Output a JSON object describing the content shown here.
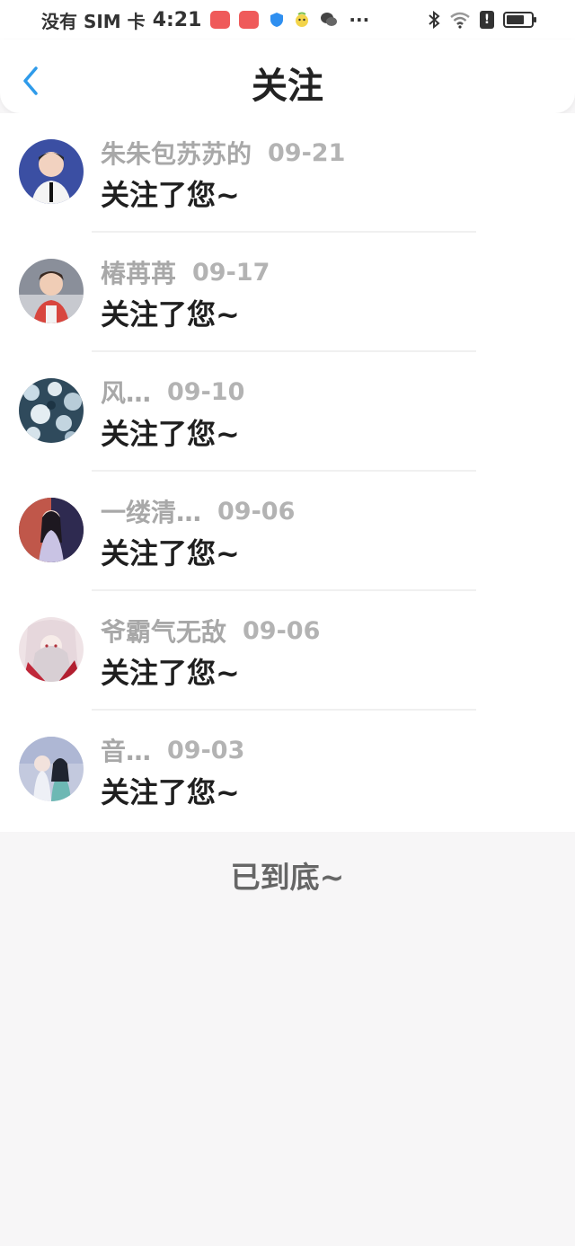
{
  "status_bar": {
    "carrier": "没有 SIM 卡",
    "time": "4:21",
    "more": "···",
    "alert": "!"
  },
  "header": {
    "title": "关注"
  },
  "notifications": [
    {
      "name": "朱朱包苏苏的",
      "date": "09-21",
      "message": "关注了您~"
    },
    {
      "name": "椿苒苒",
      "date": "09-17",
      "message": "关注了您~"
    },
    {
      "name": "风…",
      "date": "09-10",
      "message": "关注了您~"
    },
    {
      "name": "一缕清…",
      "date": "09-06",
      "message": "关注了您~"
    },
    {
      "name": "爷霸气无敌",
      "date": "09-06",
      "message": "关注了您~"
    },
    {
      "name": "音…",
      "date": "09-03",
      "message": "关注了您~"
    }
  ],
  "footer": {
    "end_label": "已到底~"
  },
  "colors": {
    "accent": "#2f9bea",
    "background": "#f7f6f7"
  }
}
